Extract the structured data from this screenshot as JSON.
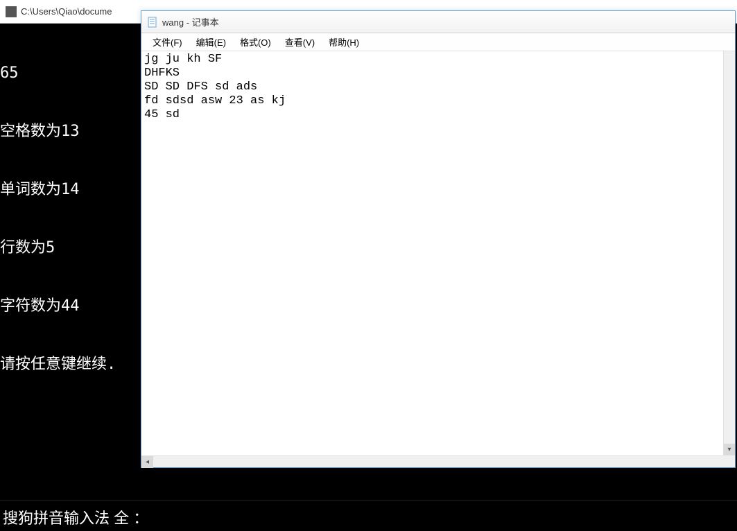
{
  "console": {
    "title": "C:\\Users\\Qiao\\docume",
    "lines": [
      "65",
      "空格数为13",
      "单词数为14",
      "行数为5",
      "字符数为44",
      "请按任意键继续."
    ],
    "ime_status": "搜狗拼音输入法  全 ："
  },
  "notepad": {
    "title": "wang - 记事本",
    "menu": {
      "file": "文件(F)",
      "edit": "编辑(E)",
      "format": "格式(O)",
      "view": "查看(V)",
      "help": "帮助(H)"
    },
    "content": "jg ju kh SF\nDHFKS\nSD SD DFS sd ads\nfd sdsd asw 23 as kj\n45 sd"
  }
}
